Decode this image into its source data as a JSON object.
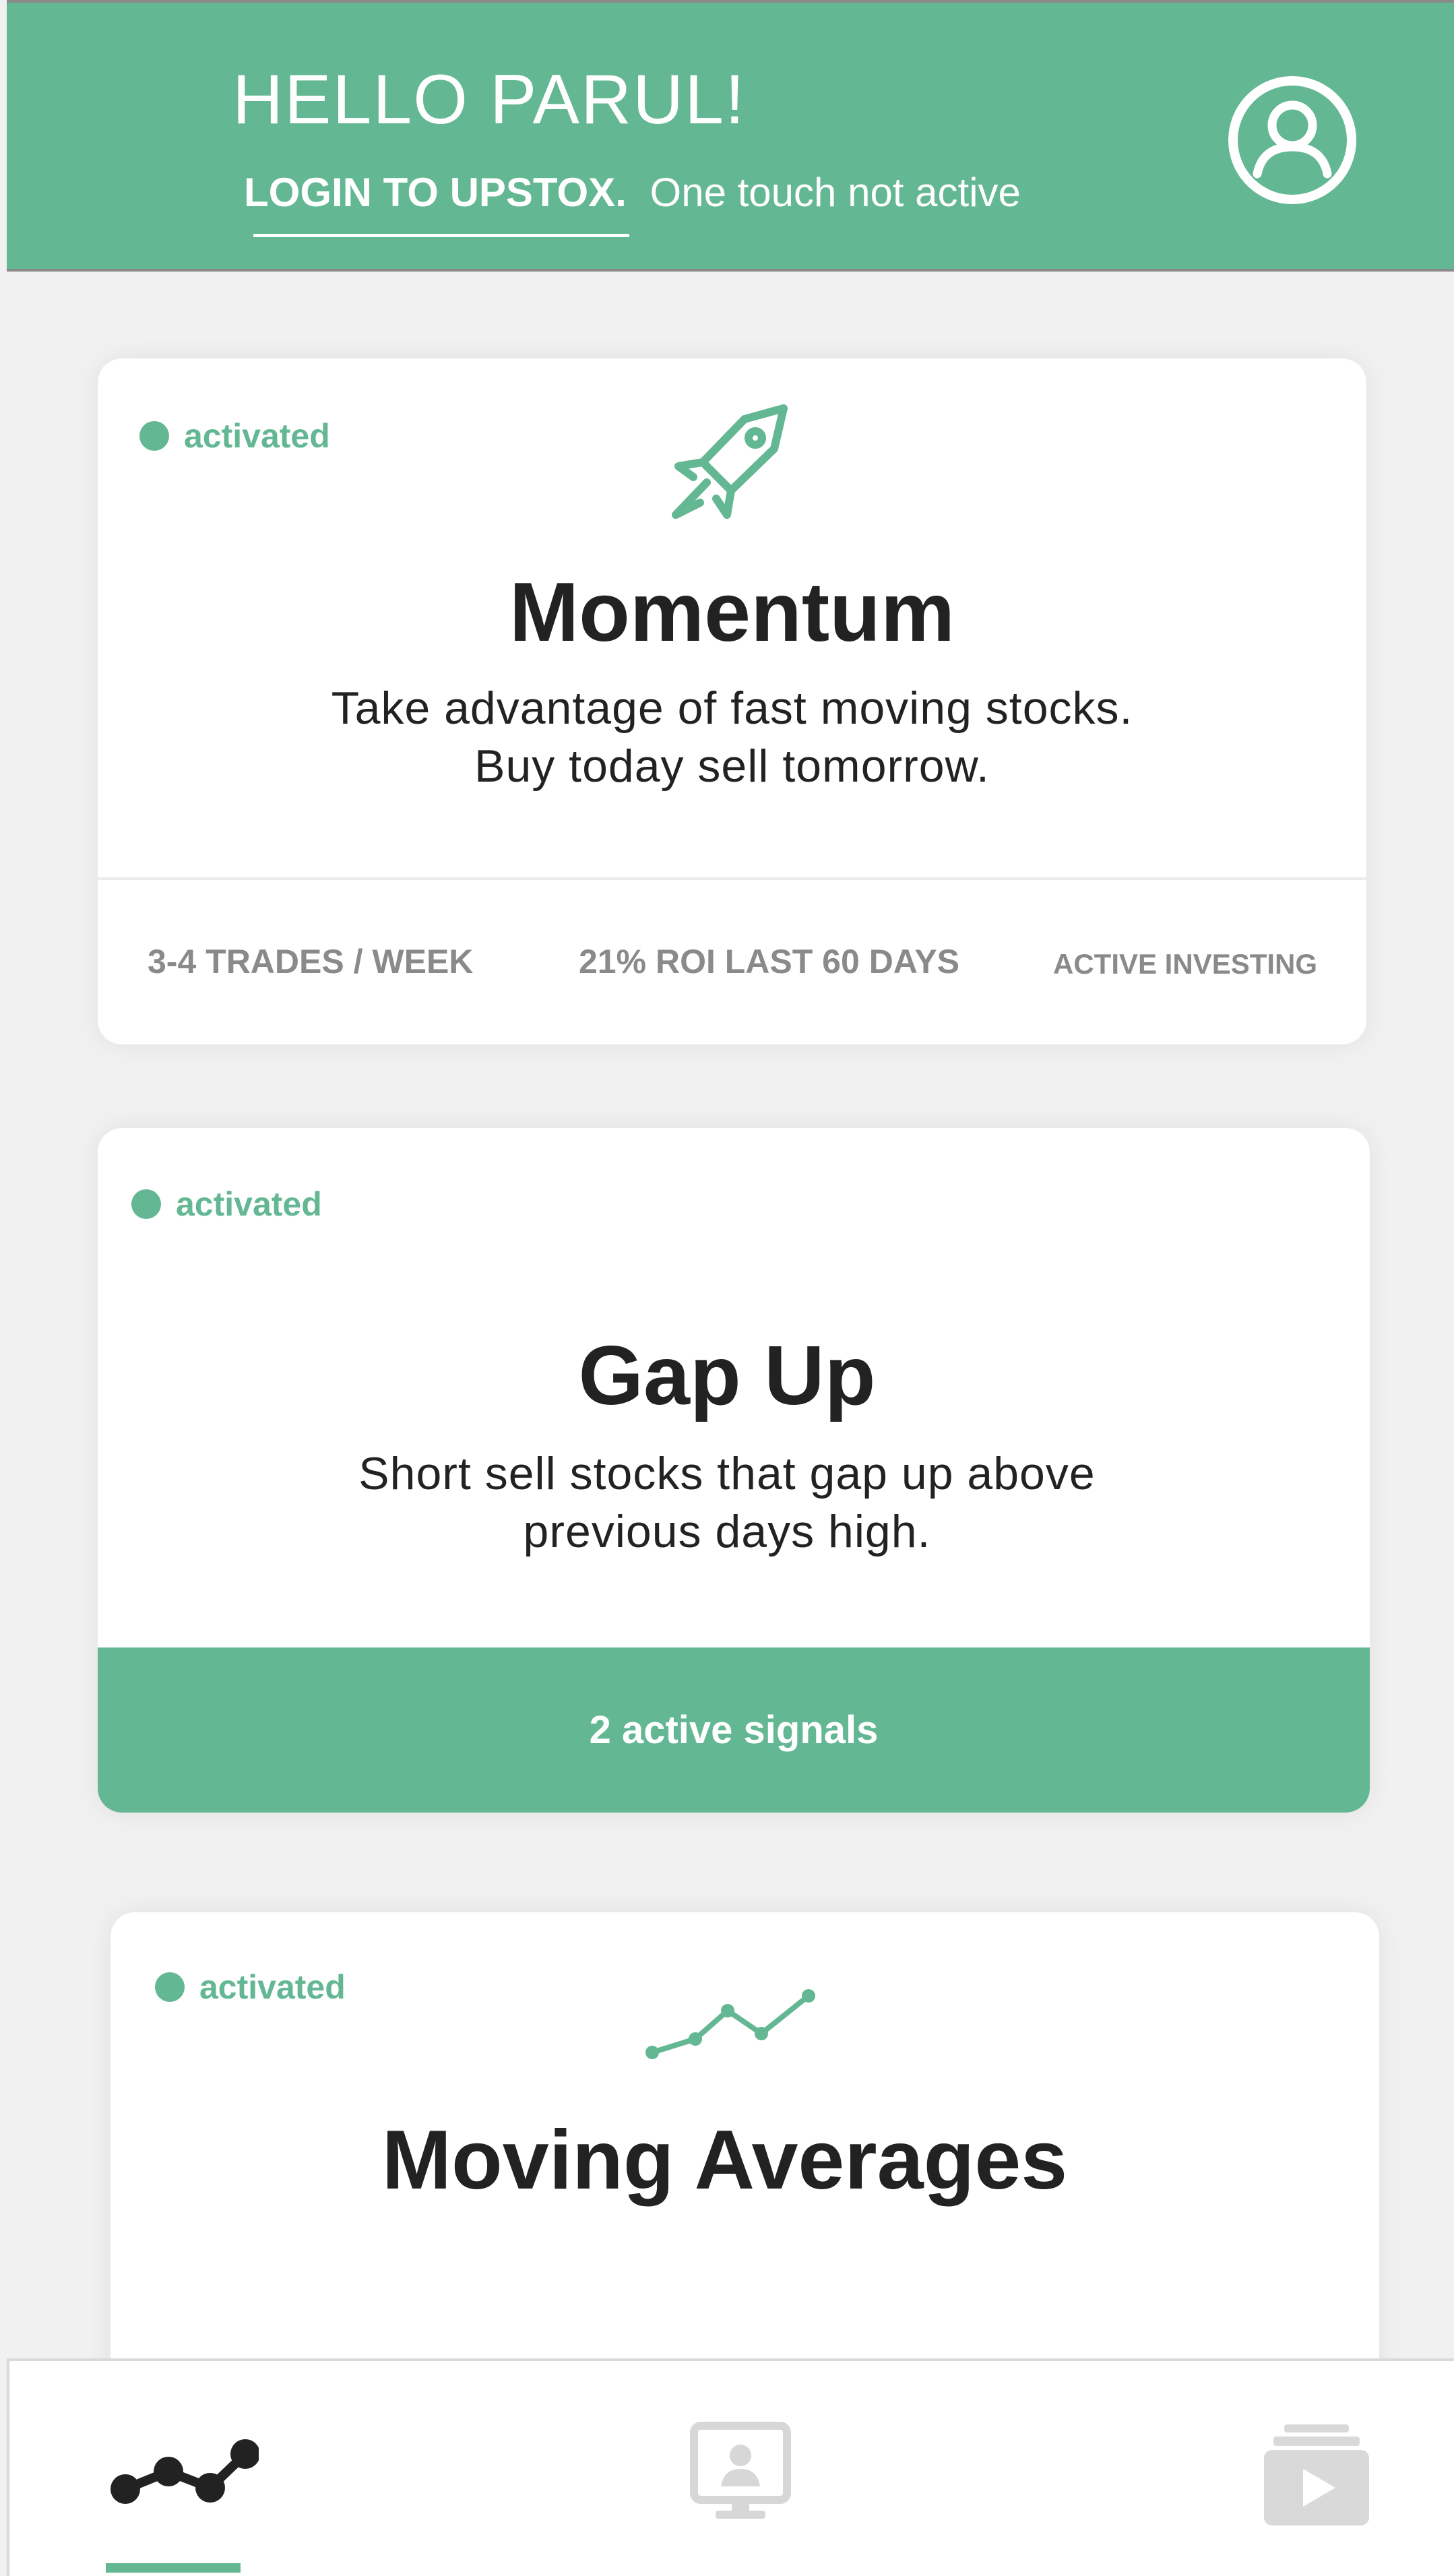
{
  "header": {
    "greeting": "HELLO PARUL!",
    "login_link": "LOGIN TO UPSTOX.",
    "login_status": "One touch not active",
    "profile_icon": "user-circle-icon",
    "background_color": "#63b792"
  },
  "strategies": [
    {
      "status": "activated",
      "icon": "rocket-icon",
      "title": "Momentum",
      "description_line1": "Take advantage of fast moving stocks.",
      "description_line2": "Buy today sell tomorrow.",
      "stats": [
        "3-4 TRADES / WEEK",
        "21% ROI LAST 60 DAYS",
        "ACTIVE INVESTING"
      ]
    },
    {
      "status": "activated",
      "title": "Gap Up",
      "description_line1": "Short sell stocks that gap up above",
      "description_line2": "previous days high.",
      "signals": "2 active signals"
    },
    {
      "status": "activated",
      "icon": "line-chart-icon",
      "title": "Moving Averages"
    }
  ],
  "bottom_nav": {
    "items": [
      {
        "icon": "chart-line-icon",
        "active": true
      },
      {
        "icon": "monitor-user-icon",
        "active": false
      },
      {
        "icon": "video-stack-icon",
        "active": false
      }
    ]
  },
  "colors": {
    "accent": "#63b792",
    "text_dark": "#222222",
    "text_muted": "#8a8a8a",
    "background": "#f1f1f1"
  }
}
